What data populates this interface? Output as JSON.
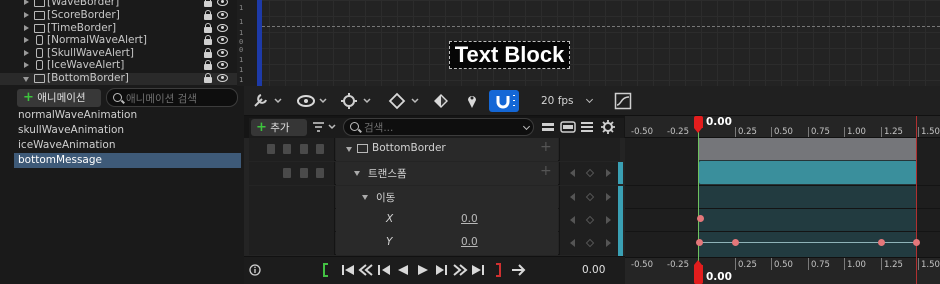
{
  "hierarchy": {
    "items": [
      {
        "label": "[WaveBorder]",
        "icon": "border-icon"
      },
      {
        "label": "[ScoreBorder]",
        "icon": "border-icon"
      },
      {
        "label": "[TimeBorder]",
        "icon": "border-icon"
      },
      {
        "label": "[NormalWaveAlert]",
        "icon": "phone-widget-icon"
      },
      {
        "label": "[SkullWaveAlert]",
        "icon": "phone-widget-icon"
      },
      {
        "label": "[IceWaveAlert]",
        "icon": "phone-widget-icon"
      },
      {
        "label": "[BottomBorder]",
        "icon": "border-icon"
      }
    ]
  },
  "designer": {
    "text_block": "Text Block",
    "ruler_labels": [
      "1",
      "1",
      "1",
      "0",
      "0",
      "1",
      "1",
      "1"
    ]
  },
  "animations": {
    "add_label": "애니메이션",
    "search_placeholder": "애니메이션 검색",
    "items": [
      "normalWaveAnimation",
      "skullWaveAnimation",
      "iceWaveAnimation",
      "bottomMessage"
    ],
    "selected_index": 3
  },
  "sequencer": {
    "fps_label": "20 fps",
    "add_track_label": "추가",
    "search_placeholder": "검색...",
    "tracks": [
      {
        "label": "BottomBorder",
        "icon": "border-icon"
      },
      {
        "label": "트랜스폼"
      },
      {
        "label": "이동"
      },
      {
        "label": "X",
        "value": "0.0"
      },
      {
        "label": "Y",
        "value": "0.0"
      }
    ],
    "current_time": "0.00"
  },
  "timeline": {
    "tick_labels": [
      "-0.50",
      "-0.25",
      "0.25",
      "0.50",
      "0.75",
      "1.00",
      "1.25",
      "1.50"
    ],
    "playhead_time": "0.00",
    "colors": {
      "playhead": "#e31d1d",
      "start_marker": "#6ec25e",
      "end_marker": "#b03030",
      "keyframe": "#e4777a",
      "section_teal": "#3a8f9c",
      "section_gray": "#75767a"
    }
  }
}
